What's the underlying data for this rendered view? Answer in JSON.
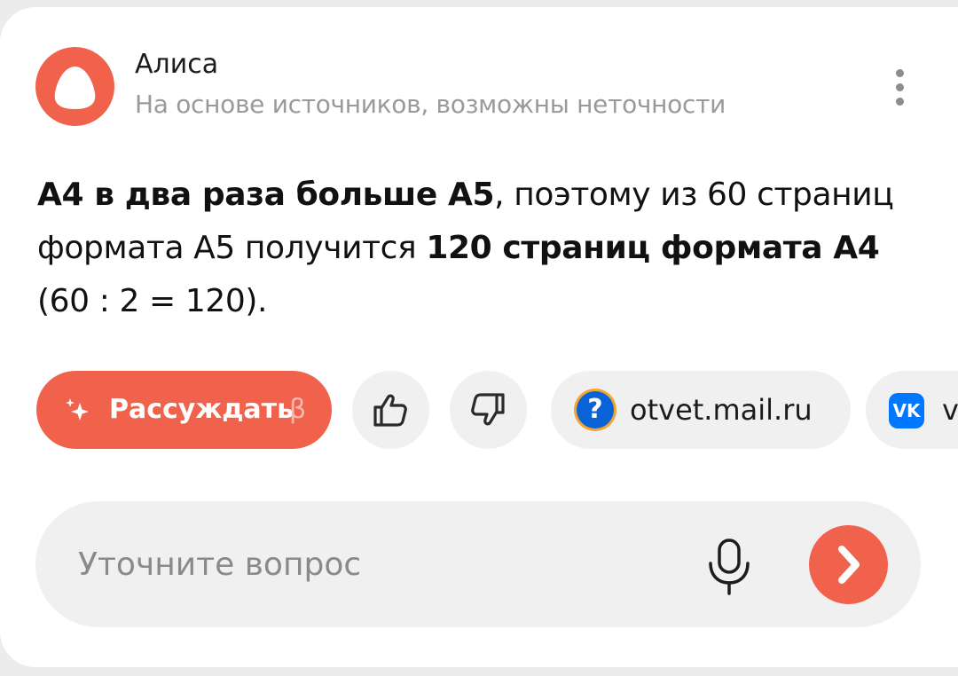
{
  "header": {
    "title": "Алиса",
    "subtitle": "На основе источников, возможны неточности",
    "avatar_icon": "alice-logo-icon",
    "menu_icon": "more-vertical-icon"
  },
  "answer": {
    "part1_bold": "А4 в два раза больше А5",
    "part2": ", поэтому из 60 страниц формата А5 получится ",
    "part3_bold": "120 страниц формата А4",
    "part4": " (60 : 2 = 120)."
  },
  "actions": {
    "think_label": "Рассуждать",
    "think_badge": "β",
    "think_icon": "sparkle-icon",
    "like_icon": "thumbs-up-icon",
    "dislike_icon": "thumbs-down-icon"
  },
  "sources": [
    {
      "label": "otvet.mail.ru",
      "icon": "otvet-mail-icon",
      "icon_glyph": "?"
    },
    {
      "label": "v",
      "icon": "vk-icon",
      "icon_glyph": "VK"
    }
  ],
  "input": {
    "placeholder": "Уточните вопрос",
    "value": ""
  },
  "colors": {
    "accent": "#f1624d",
    "chip_bg": "#f0f0f0",
    "muted_text": "#9a9a9a"
  }
}
